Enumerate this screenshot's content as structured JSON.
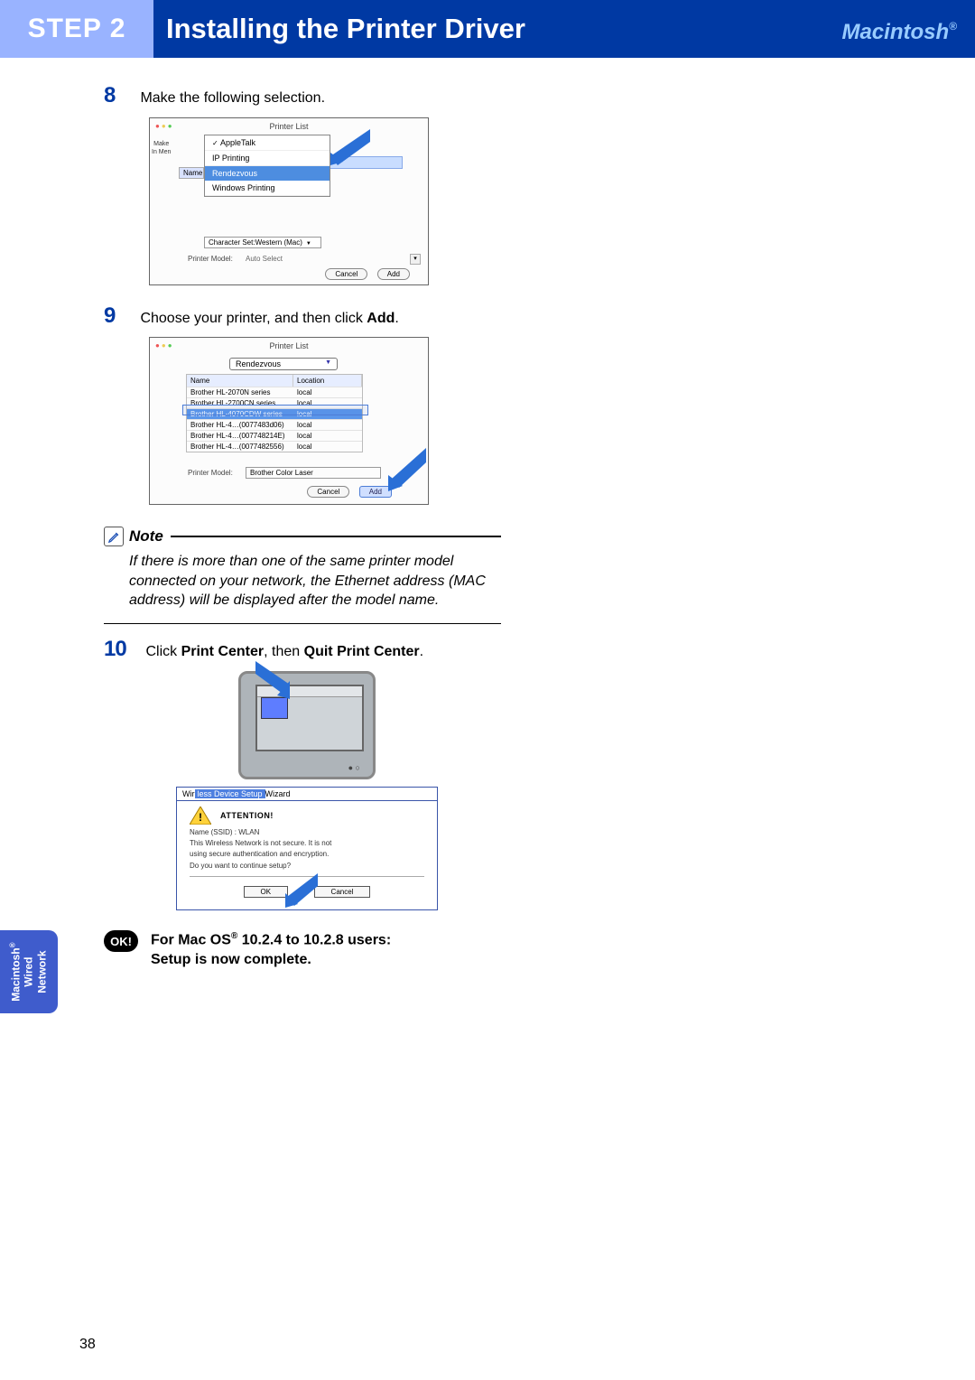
{
  "header": {
    "step_label": "STEP 2",
    "title": "Installing the Printer Driver",
    "platform": "Macintosh",
    "platform_sup": "®"
  },
  "side_tab": {
    "line1": "Macintosh",
    "sup": "®",
    "line2": "Wired",
    "line3": "Network"
  },
  "page_number": "38",
  "step8": {
    "num": "8",
    "text": "Make the following selection.",
    "window_title": "Printer List",
    "left_label1": "Make",
    "left_label2": "In Men",
    "dd_appletalk": "AppleTalk",
    "dd_ip": "IP Printing",
    "dd_rendezvous": "Rendezvous",
    "dd_windows": "Windows Printing",
    "name_hdr": "Name",
    "charset": "Character Set:Western (Mac)",
    "pm_label": "Printer Model:",
    "pm_val": "Auto Select",
    "btn_cancel": "Cancel",
    "btn_add": "Add"
  },
  "step9": {
    "num": "9",
    "text_a": "Choose your printer, and then click ",
    "text_b": "Add",
    "text_c": ".",
    "window_title": "Printer List",
    "dd_val": "Rendezvous",
    "th_name": "Name",
    "th_loc": "Location",
    "rows": [
      {
        "name": "Brother HL-2070N series",
        "loc": "local"
      },
      {
        "name": "Brother HL-2700CN series",
        "loc": "local"
      },
      {
        "name": "Brother HL-4070CDW series",
        "loc": "local"
      },
      {
        "name": "Brother HL-4…(0077483d06)",
        "loc": "local"
      },
      {
        "name": "Brother HL-4…(007748214E)",
        "loc": "local"
      },
      {
        "name": "Brother HL-4…(0077482556)",
        "loc": "local"
      }
    ],
    "pm_label": "Printer Model:",
    "pm_val": "Brother Color Laser",
    "btn_cancel": "Cancel",
    "btn_add": "Add"
  },
  "note": {
    "label": "Note",
    "body": "If there is more than one of the same printer model connected on your network, the Ethernet address (MAC address) will be displayed after the model name."
  },
  "step10": {
    "num": "10",
    "a": "Click ",
    "b": "Print Center",
    "c": ", then ",
    "d": "Quit Print Center",
    "e": ".",
    "wizard_title_a": "Wir",
    "wizard_title_hl": "less Device Setup",
    "wizard_title_b": "Wizard",
    "attention": "ATTENTION!",
    "ssid": "Name (SSID) : WLAN",
    "warn1": "This Wireless Network is not secure. It is not",
    "warn2": "using secure authentication and encryption.",
    "warn3": "Do you want to continue setup?",
    "btn_ok": "OK",
    "btn_cancel": "Cancel"
  },
  "ok": {
    "badge": "OK!",
    "a": "For Mac OS",
    "sup": "®",
    "b": " 10.2.4 to 10.2.8 users:",
    "c": "Setup is now complete."
  }
}
